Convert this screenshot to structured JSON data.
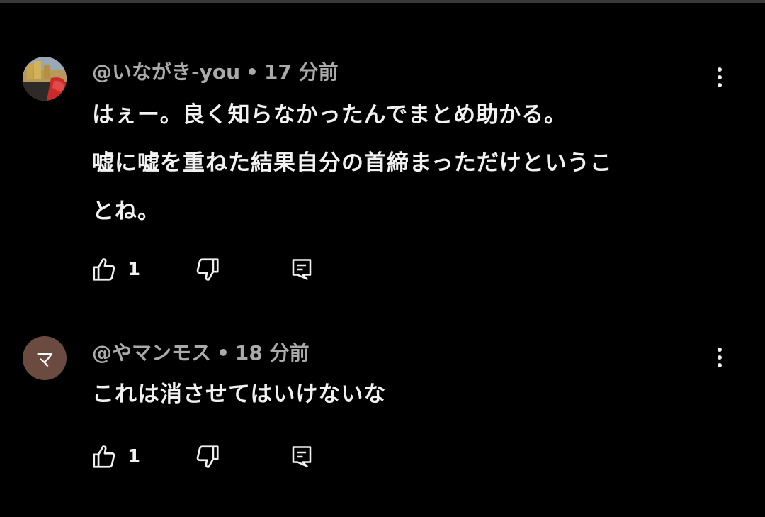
{
  "comments": [
    {
      "author": "@いながき-you",
      "separator": "•",
      "time": "17 分前",
      "avatar_icon": "photo-avatar",
      "avatar_initial": "",
      "lines": [
        "はぇー。良く知らなかったんでまとめ助かる。",
        "嘘に嘘を重ねた結果自分の首締まっただけというこ",
        "とね。"
      ],
      "like_count": "1",
      "icons": {
        "like": "thumbs-up-icon",
        "dislike": "thumbs-down-icon",
        "reply": "reply-comment-icon",
        "more": "more-vertical-icon"
      }
    },
    {
      "author": "@やマンモス",
      "separator": "•",
      "time": "18 分前",
      "avatar_icon": "initial-avatar",
      "avatar_initial": "マ",
      "lines": [
        "これは消させてはいけないな"
      ],
      "like_count": "1",
      "icons": {
        "like": "thumbs-up-icon",
        "dislike": "thumbs-down-icon",
        "reply": "reply-comment-icon",
        "more": "more-vertical-icon"
      }
    }
  ],
  "colors": {
    "background": "#000000",
    "text_primary": "#f1f1f1",
    "text_secondary": "#aaaaaa",
    "avatar_initial_bg": "#6b4a3f"
  }
}
